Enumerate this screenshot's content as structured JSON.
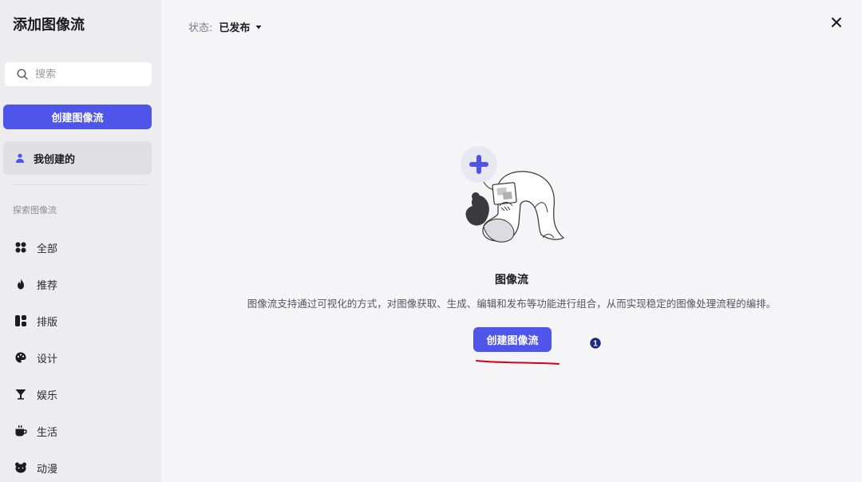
{
  "sidebar": {
    "title": "添加图像流",
    "search_placeholder": "搜索",
    "create_label": "创建图像流",
    "mine_label": "我创建的",
    "section_label": "探索图像流",
    "nav": [
      {
        "label": "全部",
        "icon": "grid-dots-icon"
      },
      {
        "label": "推荐",
        "icon": "flame-icon"
      },
      {
        "label": "排版",
        "icon": "layout-icon"
      },
      {
        "label": "设计",
        "icon": "palette-icon"
      },
      {
        "label": "娱乐",
        "icon": "cocktail-icon"
      },
      {
        "label": "生活",
        "icon": "cup-icon"
      },
      {
        "label": "动漫",
        "icon": "bear-icon"
      }
    ]
  },
  "header": {
    "status_label": "状态:",
    "status_value": "已发布"
  },
  "empty": {
    "title": "图像流",
    "description": "图像流支持通过可视化的方式，对图像获取、生成、编辑和发布等功能进行组合，从而实现稳定的图像处理流程的编排。",
    "create_label": "创建图像流"
  },
  "annotation": {
    "step_number": "1",
    "underline_color": "#d0021b"
  },
  "colors": {
    "accent": "#4f55e8",
    "sidebar_bg": "#ededf0",
    "main_bg": "#f5f5f8"
  }
}
